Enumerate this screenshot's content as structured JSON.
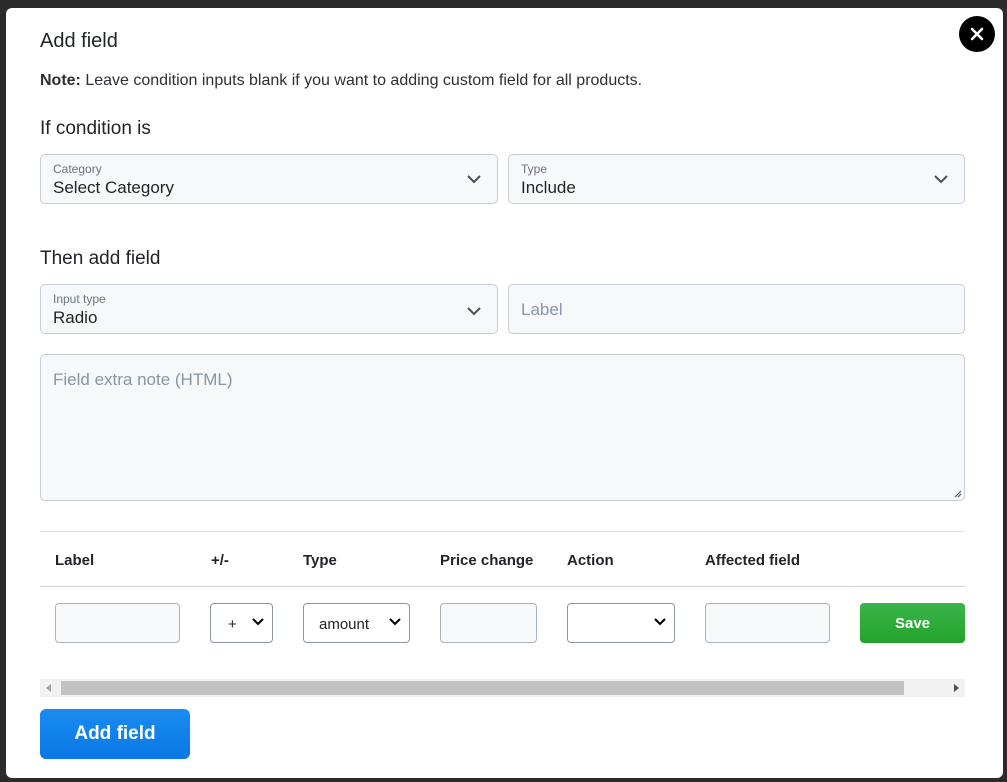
{
  "modal": {
    "title": "Add field",
    "note_bold": "Note:",
    "note_text": " Leave condition inputs blank if you want to adding custom field for all products."
  },
  "condition": {
    "heading": "If condition is",
    "category": {
      "label": "Category",
      "value": "Select Category"
    },
    "type": {
      "label": "Type",
      "value": "Include"
    }
  },
  "field": {
    "heading": "Then add field",
    "input_type": {
      "label": "Input type",
      "value": "Radio"
    },
    "label_placeholder": "Label",
    "note_placeholder": "Field extra note (HTML)"
  },
  "table": {
    "headers": [
      "Label",
      "+/-",
      "Type",
      "Price change",
      "Action",
      "Affected field"
    ],
    "row": {
      "sign": "+",
      "type": "amount",
      "save_label": "Save"
    }
  },
  "footer": {
    "add_field_label": "Add field"
  },
  "icons": {
    "close": "close-icon",
    "chevron": "chevron-down-icon"
  },
  "colors": {
    "save": "#28a745",
    "primary": "#0d7ee9"
  }
}
